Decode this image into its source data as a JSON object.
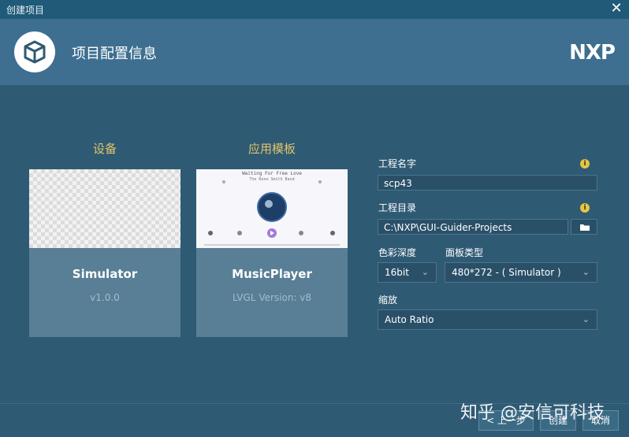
{
  "window": {
    "title": "创建项目",
    "close_icon": "close-icon"
  },
  "header": {
    "title": "项目配置信息",
    "logo_icon": "cube-icon",
    "brand": "NXP"
  },
  "device": {
    "heading": "设备",
    "card": {
      "name": "Simulator",
      "version": "v1.0.0"
    }
  },
  "template": {
    "heading": "应用模板",
    "card": {
      "name": "MusicPlayer",
      "version": "LVGL Version: v8"
    },
    "preview": {
      "song_title": "Waiting For Free Love",
      "artist": "The Rene Smith Band"
    }
  },
  "form": {
    "project_name": {
      "label": "工程名字",
      "value": "scp43"
    },
    "project_dir": {
      "label": "工程目录",
      "value": "C:\\NXP\\GUI-Guider-Projects"
    },
    "color_depth": {
      "label": "色彩深度",
      "value": "16bit"
    },
    "board_type": {
      "label": "面板类型",
      "value": "480*272 - ( Simulator )"
    },
    "scale": {
      "label": "缩放",
      "value": "Auto Ratio"
    }
  },
  "footer": {
    "prev_label": "< 上一步",
    "create_label": "创建",
    "cancel_label": "取消"
  },
  "watermark": "知乎 @安信可科技",
  "colors": {
    "accent_heading": "#e3c46b",
    "background": "#2f5a73",
    "header": "#3e6f90",
    "card": "#587f95"
  }
}
